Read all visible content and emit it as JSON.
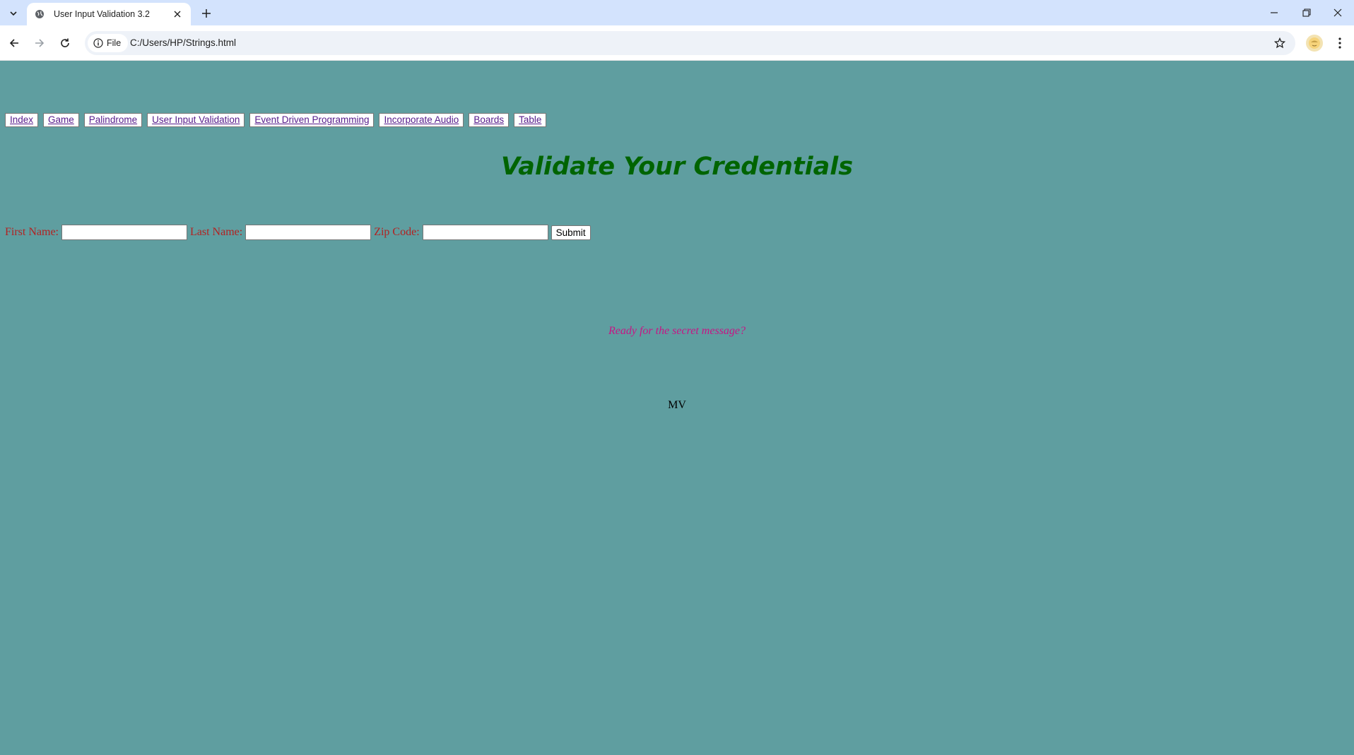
{
  "browser": {
    "tab_title": "User Input Validation 3.2",
    "site_chip_label": "File",
    "url": "C:/Users/HP/Strings.html"
  },
  "nav_links": [
    {
      "label": "Index"
    },
    {
      "label": "Game"
    },
    {
      "label": "Palindrome"
    },
    {
      "label": "User Input Validation"
    },
    {
      "label": "Event Driven Programming"
    },
    {
      "label": "Incorporate Audio"
    },
    {
      "label": "Boards"
    },
    {
      "label": "Table"
    }
  ],
  "heading": "Validate Your Credentials",
  "form": {
    "first_name_label": "First Name:",
    "first_name_value": "",
    "last_name_label": "Last Name:",
    "last_name_value": "",
    "zip_label": "Zip Code:",
    "zip_value": "",
    "submit_label": "Submit"
  },
  "secret_message": "Ready for the secret message?",
  "footer_initials": "MV",
  "colors": {
    "page_background": "#5f9ea0",
    "heading": "#006400",
    "form_labels": "#b22222",
    "secret_message": "#c71585",
    "link": "#551a8b"
  },
  "icons": {
    "tab_search": "chevron-down-icon",
    "favicon": "globe-icon",
    "tab_close": "close-icon",
    "new_tab": "plus-icon",
    "back": "arrow-left-icon",
    "forward": "arrow-right-icon",
    "reload": "reload-icon",
    "site_info": "info-icon",
    "bookmark": "star-icon",
    "profile": "avatar-icon",
    "menu": "kebab-menu-icon",
    "minimize": "minimize-icon",
    "restore": "restore-icon",
    "close_window": "close-window-icon"
  }
}
